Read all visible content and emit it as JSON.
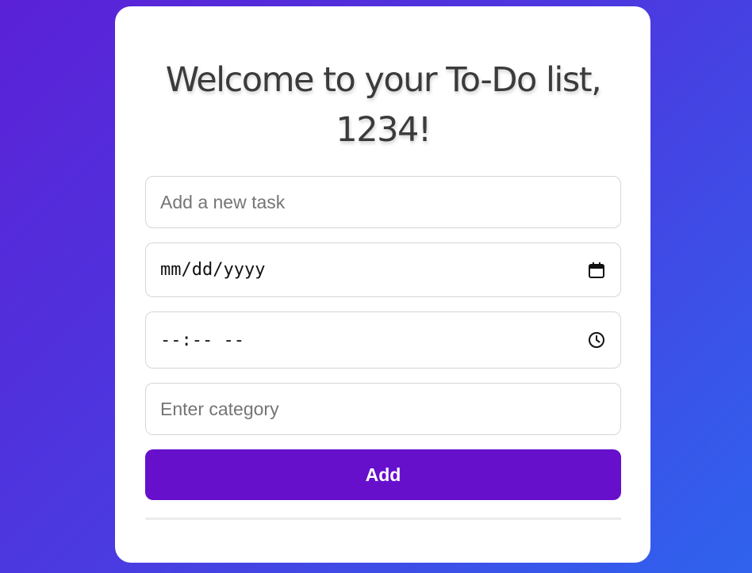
{
  "header": {
    "title": "Welcome to your To-Do list, 1234!"
  },
  "form": {
    "task_placeholder": "Add a new task",
    "date_placeholder": "mm/dd/yyyy",
    "date_icon": "calendar-icon",
    "time_placeholder": "--:-- --",
    "time_icon": "clock-icon",
    "category_placeholder": "Enter category",
    "add_label": "Add"
  },
  "colors": {
    "background_start": "#5b21d6",
    "background_end": "#2f63ee",
    "card": "#ffffff",
    "button": "#6610cc",
    "title_text": "#3b3b3b"
  }
}
